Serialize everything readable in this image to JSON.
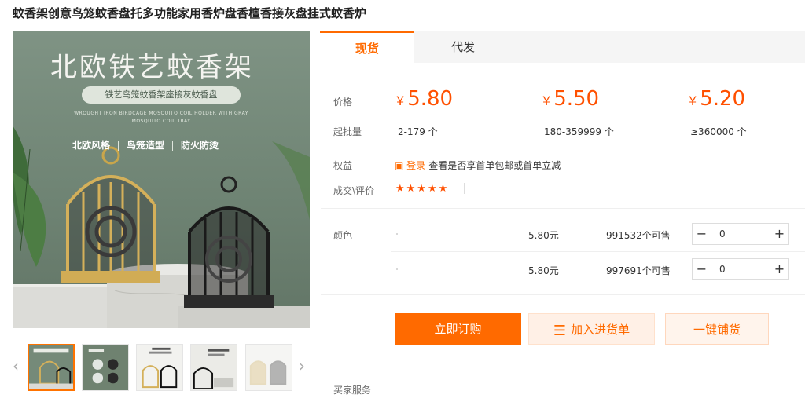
{
  "product": {
    "title": "蚊香架创意鸟笼蚊香盘托多功能家用香炉盘香檀香接灰盘挂式蚊香炉"
  },
  "main_image": {
    "headline": "北欧铁艺蚊香架",
    "pill": "铁艺鸟笼蚊香架座接灰蚊香盘",
    "subtext": "WROUGHT IRON BIRDCAGE MOSQUITO COIL HOLDER WITH GRAY MOSQUITO COIL TRAY",
    "features": [
      "北欧风格",
      "鸟笼造型",
      "防火防烫"
    ]
  },
  "tabs": {
    "active": "现货",
    "inactive": "代发"
  },
  "pricing": {
    "price_label": "价格",
    "moq_label": "起批量",
    "currency": "¥",
    "tiers": [
      {
        "price": "5.80",
        "qty": "2-179 个"
      },
      {
        "price": "5.50",
        "qty": "180-359999 个"
      },
      {
        "price": "5.20",
        "qty": "≥360000 个"
      }
    ]
  },
  "benefits": {
    "label": "权益",
    "icon": "coupon-icon",
    "login_text": "登录",
    "text": "查看是否享首单包邮或首单立减"
  },
  "reviews": {
    "label": "成交\\评价",
    "stars": "★★★★★",
    "rating": 5
  },
  "variants": {
    "label": "颜色",
    "rows": [
      {
        "price": "5.80元",
        "stock": "991532个可售",
        "qty": "0"
      },
      {
        "price": "5.80元",
        "stock": "997691个可售",
        "qty": "0"
      }
    ],
    "minus": "−",
    "plus": "+"
  },
  "actions": {
    "buy": "立即订购",
    "cart": "加入进货单",
    "distribute": "一键铺货"
  },
  "footer": {
    "service_label": "买家服务"
  },
  "nav": {
    "prev": "‹",
    "next": "›"
  },
  "colors": {
    "accent": "#ff6a00",
    "price": "#ff5000"
  }
}
